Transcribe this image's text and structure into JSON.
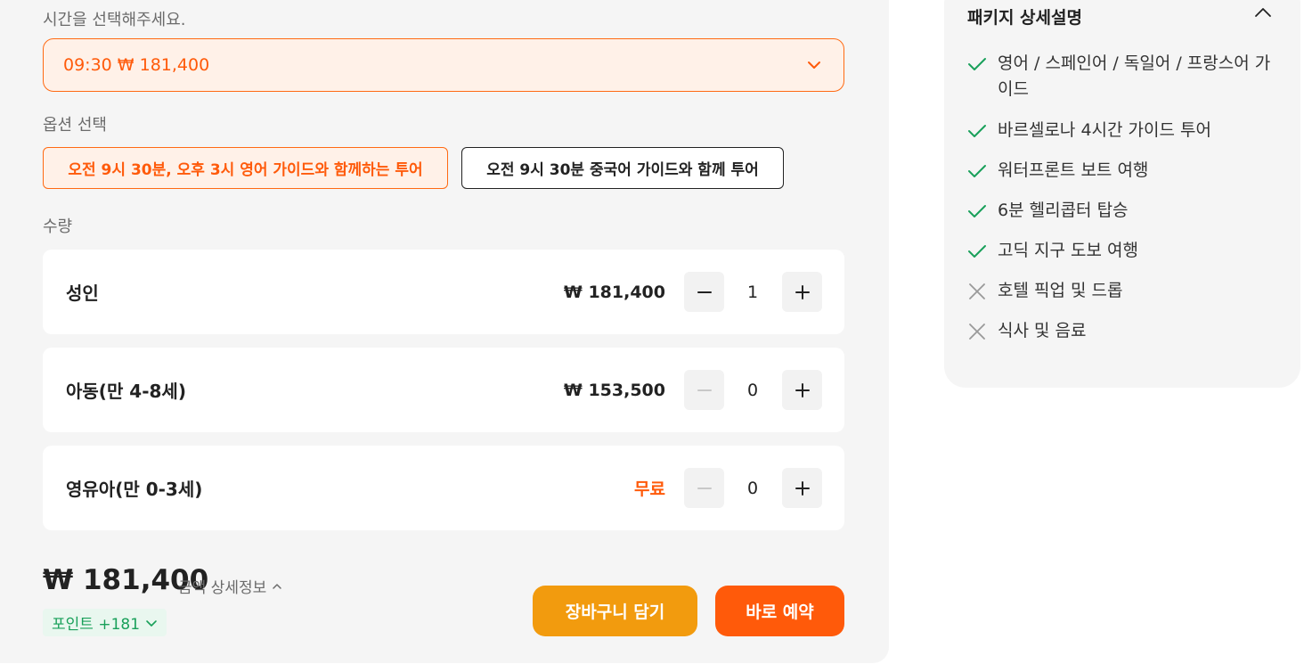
{
  "time_section": {
    "label": "시간을 선택해주세요.",
    "selected_value": "09:30 ₩ 181,400"
  },
  "option_section": {
    "label": "옵션 선택",
    "options": [
      {
        "label": "오전 9시 30분, 오후 3시 영어 가이드와 함께하는 투어",
        "selected": true
      },
      {
        "label": "오전 9시 30분 중국어 가이드와 함께 투어",
        "selected": false
      }
    ]
  },
  "quantity_section": {
    "label": "수량",
    "rows": [
      {
        "name": "성인",
        "price": "₩ 181,400",
        "count": "1",
        "minus_enabled": true
      },
      {
        "name": "아동(만 4-8세)",
        "price": "₩ 153,500",
        "count": "0",
        "minus_enabled": false
      },
      {
        "name": "영유아(만 0-3세)",
        "price": "무료",
        "count": "0",
        "minus_enabled": false
      }
    ]
  },
  "summary": {
    "total": "₩ 181,400",
    "detail_link": "금액 상세정보",
    "points": "포인트 +181",
    "cart_button": "장바구니 담기",
    "book_button": "바로 예약"
  },
  "package": {
    "title": "패키지 상세설명",
    "features": [
      {
        "text": "영어 / 스페인어 / 독일어 / 프랑스어 가이드",
        "included": true
      },
      {
        "text": "바르셀로나 4시간 가이드 투어",
        "included": true
      },
      {
        "text": "워터프론트 보트 여행",
        "included": true
      },
      {
        "text": "6분 헬리콥터 탑승",
        "included": true
      },
      {
        "text": "고딕 지구 도보 여행",
        "included": true
      },
      {
        "text": "호텔 픽업 및 드롭",
        "included": false
      },
      {
        "text": "식사 및 음료",
        "included": false
      }
    ]
  },
  "colors": {
    "accent": "#ff5a0a",
    "cart": "#f29b0e",
    "check": "#19a05a",
    "cross": "#9a9a9a"
  }
}
